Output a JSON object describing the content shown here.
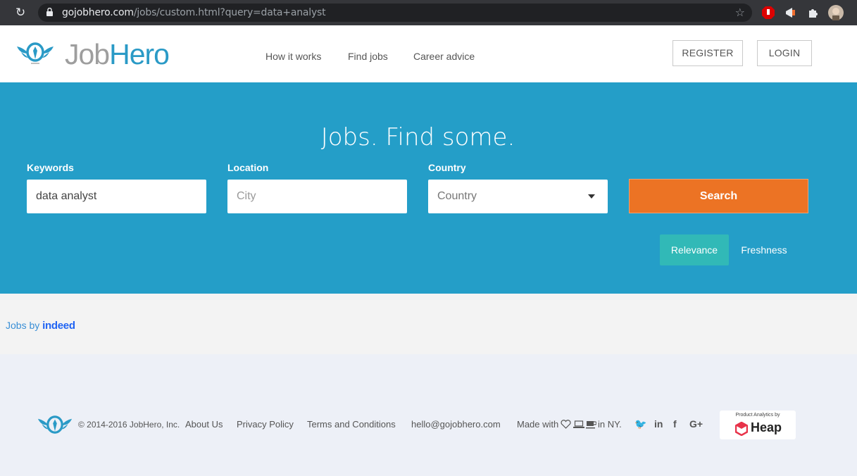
{
  "browser": {
    "url_host": "gojobhero.com",
    "url_path": "/jobs/custom.html?query=data+analyst"
  },
  "header": {
    "logo_job": "Job",
    "logo_hero": "Hero",
    "nav": [
      "How it works",
      "Find jobs",
      "Career advice"
    ],
    "register_label": "REGISTER",
    "login_label": "LOGIN"
  },
  "hero": {
    "title": "Jobs. Find some.",
    "keywords_label": "Keywords",
    "keywords_value": "data analyst",
    "location_label": "Location",
    "location_placeholder": "City",
    "country_label": "Country",
    "country_value": "Country",
    "search_label": "Search",
    "sort_relevance": "Relevance",
    "sort_freshness": "Freshness"
  },
  "results": {
    "jobs_by": "Jobs by",
    "provider": "indeed"
  },
  "footer": {
    "copyright": "© 2014-2016 JobHero, Inc.",
    "links": [
      "About Us",
      "Privacy Policy",
      "Terms and Conditions",
      "hello@gojobhero.com"
    ],
    "made_with": "Made with",
    "in_ny": "in NY.",
    "social_icons": [
      "twitter-icon",
      "linkedin-icon",
      "facebook-icon",
      "google-plus-icon"
    ],
    "heap_caption": "Product Analytics by",
    "heap_name": "Heap"
  },
  "colors": {
    "brand_blue": "#249ec8",
    "search_orange": "#ec7324",
    "relevance_teal": "#31b9b7"
  }
}
